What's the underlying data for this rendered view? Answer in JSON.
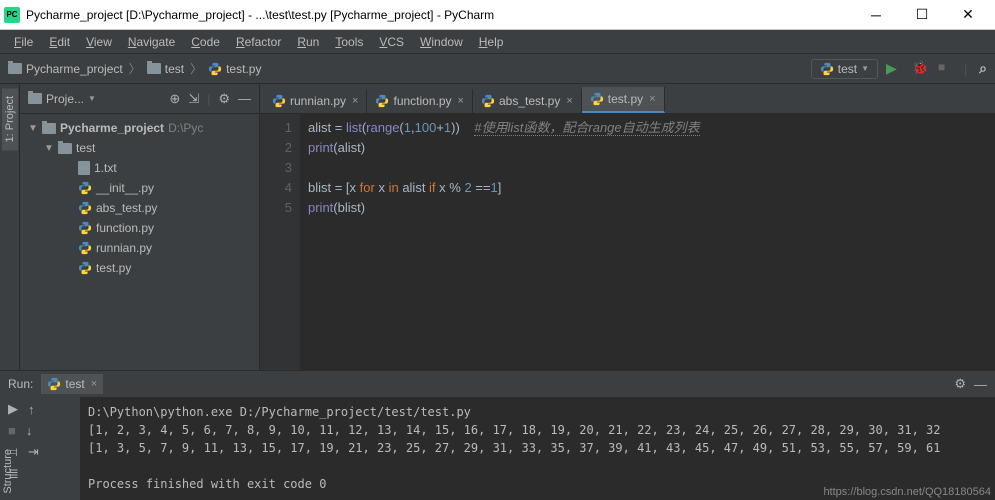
{
  "title": "Pycharme_project [D:\\Pycharme_project] - ...\\test\\test.py [Pycharme_project] - PyCharm",
  "menubar": [
    "File",
    "Edit",
    "View",
    "Navigate",
    "Code",
    "Refactor",
    "Run",
    "Tools",
    "VCS",
    "Window",
    "Help"
  ],
  "breadcrumb": [
    {
      "type": "folder",
      "label": "Pycharme_project"
    },
    {
      "type": "folder",
      "label": "test"
    },
    {
      "type": "py",
      "label": "test.py"
    }
  ],
  "run_config": {
    "label": "test"
  },
  "project_panel": {
    "title": "Proje...",
    "root": {
      "label": "Pycharme_project",
      "path": "D:\\Pyc"
    },
    "folder": {
      "label": "test"
    },
    "files": [
      "1.txt",
      "__init__.py",
      "abs_test.py",
      "function.py",
      "runnian.py",
      "test.py"
    ]
  },
  "editor_tabs": [
    {
      "label": "runnian.py",
      "active": false
    },
    {
      "label": "function.py",
      "active": false
    },
    {
      "label": "abs_test.py",
      "active": false
    },
    {
      "label": "test.py",
      "active": true
    }
  ],
  "code_lines": [
    {
      "n": 1,
      "html": "alist = <fn>list</fn>(<fn>range</fn>(<num>1</num>,<num>100</num>+<num>1</num>))    <cm>#使用list函数，配合range自动生成列表</cm>"
    },
    {
      "n": 2,
      "html": "<fn>print</fn>(alist)"
    },
    {
      "n": 3,
      "html": ""
    },
    {
      "n": 4,
      "html": "blist = [x <kw>for</kw> x <kw>in</kw> alist <kw>if</kw> x % <num>2</num> ==<num>1</num>]"
    },
    {
      "n": 5,
      "html": "<fn>print</fn>(blist)"
    }
  ],
  "run_panel": {
    "title": "Run:",
    "tab": "test",
    "output": [
      "D:\\Python\\python.exe D:/Pycharme_project/test/test.py",
      "[1, 2, 3, 4, 5, 6, 7, 8, 9, 10, 11, 12, 13, 14, 15, 16, 17, 18, 19, 20, 21, 22, 23, 24, 25, 26, 27, 28, 29, 30, 31, 32",
      "[1, 3, 5, 7, 9, 11, 13, 15, 17, 19, 21, 23, 25, 27, 29, 31, 33, 35, 37, 39, 41, 43, 45, 47, 49, 51, 53, 55, 57, 59, 61",
      "",
      "Process finished with exit code 0"
    ]
  },
  "vtab_left": {
    "project": "1: Project",
    "structure": "Structure"
  },
  "watermark": "https://blog.csdn.net/QQ18180564"
}
